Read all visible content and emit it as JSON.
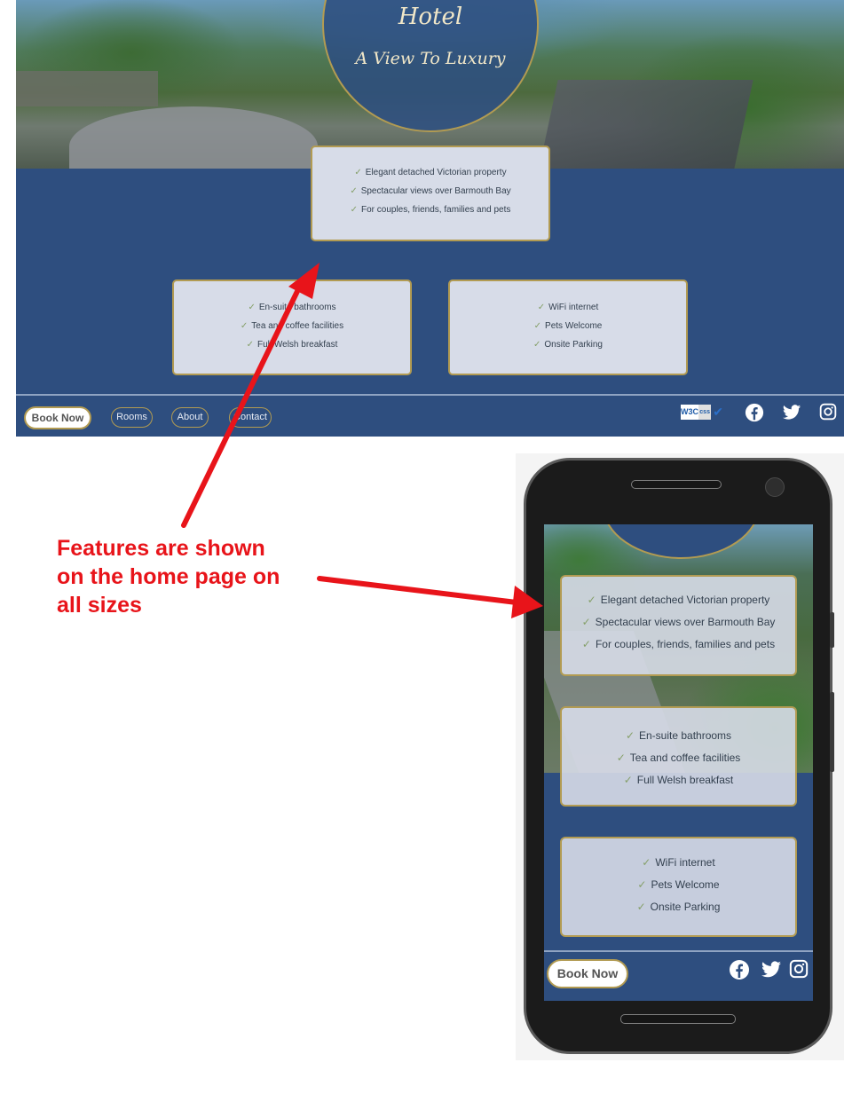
{
  "desktop": {
    "hero": {
      "title": "Hotel",
      "tagline": "A View To Luxury"
    },
    "features": [
      "Elegant detached Victorian property",
      "Spectacular views over Barmouth Bay",
      "For couples, friends, families and pets"
    ],
    "rooms_features": [
      "En-suite bathrooms",
      "Tea and coffee facilities",
      "Full Welsh breakfast"
    ],
    "amenities": [
      "WiFi internet",
      "Pets Welcome",
      "Onsite Parking"
    ],
    "tick": "✓",
    "nav": {
      "book_now": "Book Now",
      "rooms": "Rooms",
      "about": "About",
      "contact": "Contact"
    },
    "w3c_badge": {
      "w3c": "W3C",
      "css": "css",
      "check": "✔"
    },
    "social_icons": [
      "facebook-icon",
      "twitter-icon",
      "instagram-icon"
    ]
  },
  "mobile": {
    "features": [
      "Elegant detached Victorian property",
      "Spectacular views over Barmouth Bay",
      "For couples, friends, families and pets"
    ],
    "rooms_features": [
      "En-suite bathrooms",
      "Tea and coffee facilities",
      "Full Welsh breakfast"
    ],
    "amenities": [
      "WiFi internet",
      "Pets Welcome",
      "Onsite Parking"
    ],
    "book_now": "Book Now",
    "social_icons": [
      "facebook-icon",
      "twitter-icon",
      "instagram-icon"
    ]
  },
  "annotation": {
    "lines": [
      "Features are shown",
      "on the home page on",
      "all sizes"
    ],
    "color": "#e8141a"
  },
  "colors": {
    "brand_blue": "#2e4e7f",
    "gold_border": "#b29b52",
    "card_bg": "#d7dce8",
    "tick_green": "#86a06a"
  }
}
